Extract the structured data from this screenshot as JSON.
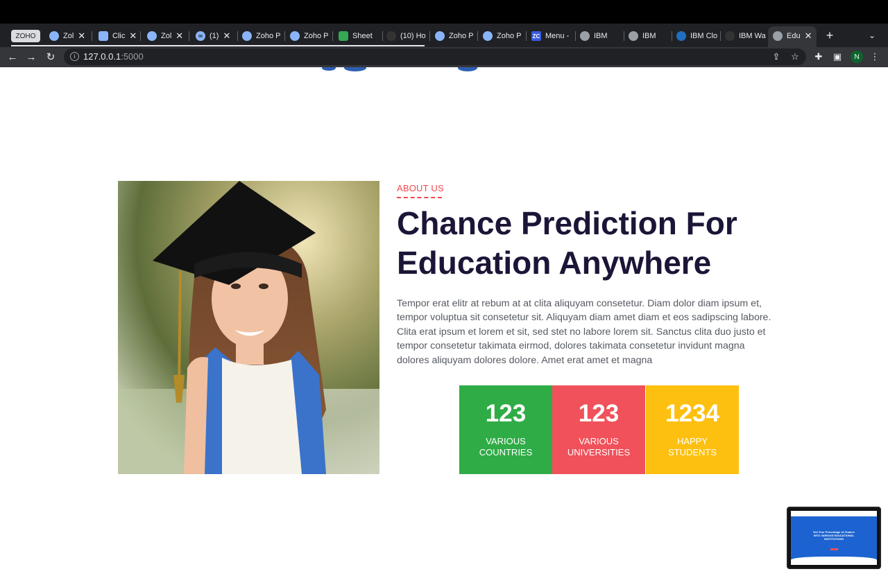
{
  "browser": {
    "tabs": [
      {
        "label": "ZOHO",
        "icon": "zoho-badge-icon"
      },
      {
        "label": "Zol",
        "icon": "zoho-projects-icon",
        "closable": true
      },
      {
        "label": "Clic",
        "icon": "chat-icon",
        "closable": true
      },
      {
        "label": "Zol",
        "icon": "zoho-projects-icon",
        "closable": true
      },
      {
        "label": "(1)",
        "icon": "mail-icon",
        "closable": true
      },
      {
        "label": "Zoho P",
        "icon": "zoho-projects-icon"
      },
      {
        "label": "Zoho P",
        "icon": "zoho-projects-icon"
      },
      {
        "label": "Sheet",
        "icon": "sheet-icon"
      },
      {
        "label": "(10) Ho",
        "icon": "slack-icon"
      },
      {
        "label": "Zoho P",
        "icon": "zoho-projects-icon"
      },
      {
        "label": "Zoho P",
        "icon": "zoho-projects-icon"
      },
      {
        "label": "Menu -",
        "icon": "zc-icon"
      },
      {
        "label": "IBM",
        "icon": "globe-icon"
      },
      {
        "label": "IBM",
        "icon": "globe-icon"
      },
      {
        "label": "IBM Clo",
        "icon": "ibm-cloud-icon"
      },
      {
        "label": "IBM Wa",
        "icon": "github-icon"
      },
      {
        "label": "Edu",
        "icon": "globe-icon",
        "closable": true,
        "active": true
      }
    ],
    "new_tab": "+",
    "url_host": "127.0.0.1",
    "url_port": ":5000",
    "profile_initial": "N"
  },
  "about": {
    "label": "ABOUT US",
    "heading_line1": "Chance Prediction For",
    "heading_line2": "Education Anywhere",
    "paragraph": "Tempor erat elitr at rebum at at clita aliquyam consetetur. Diam dolor diam ipsum et, tempor voluptua sit consetetur sit. Aliquyam diam amet diam et eos sadipscing labore. Clita erat ipsum et lorem et sit, sed stet no labore lorem sit. Sanctus clita duo justo et tempor consetetur takimata eirmod, dolores takimata consetetur invidunt magna dolores aliquyam dolores dolore. Amet erat amet et magna"
  },
  "stats": [
    {
      "value": "123",
      "label_line1": "VARIOUS",
      "label_line2": "COUNTRIES",
      "color": "#2fac46"
    },
    {
      "value": "123",
      "label_line1": "VARIOUS",
      "label_line2": "UNIVERSITIES",
      "color": "#f0515a"
    },
    {
      "value": "1234",
      "label_line1": "HAPPY",
      "label_line2": "STUDENTS",
      "color": "#fdc010"
    }
  ],
  "pip": {
    "line1": "Get Your Percentage of Chance",
    "line2": "INTO VARIOUS EDUCATIONAL",
    "line3": "INSTITUTIONS"
  },
  "colors": {
    "accent": "#f0484f",
    "heading": "#1d1537",
    "body_text": "#555a61"
  }
}
